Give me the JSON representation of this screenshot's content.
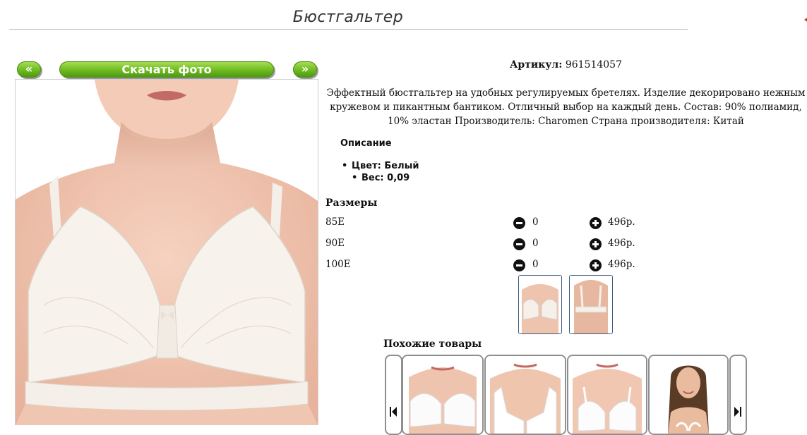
{
  "page": {
    "title": "Бюстгальтер"
  },
  "gallery": {
    "prev_label": "«",
    "download_label": "Скачать фото",
    "next_label": "»"
  },
  "product": {
    "sku_label": "Артикул:",
    "sku_value": "961514057",
    "description": "Эффектный бюстгальтер на удобных регулируемых бретелях. Изделие декорировано нежным кружевом и пикантным бантиком. Отличный выбор на каждый день. Состав: 90% полиамид, 10% эластан Производитель: Charomen Страна производителя: Китай",
    "description_heading": "Описание",
    "attributes": [
      "Цвет: Белый",
      "Вес: 0,09"
    ]
  },
  "sizes": {
    "heading": "Размеры",
    "rows": [
      {
        "size": "85E",
        "qty": "0",
        "price": "496р."
      },
      {
        "size": "90E",
        "qty": "0",
        "price": "496р."
      },
      {
        "size": "100E",
        "qty": "0",
        "price": "496р."
      }
    ]
  },
  "similar": {
    "heading": "Похожие товары"
  },
  "icons": {
    "minus": "minus-circle-icon",
    "plus": "plus-circle-icon",
    "prev": "skip-back-icon",
    "next": "skip-forward-icon"
  },
  "colors": {
    "button_green": "#6dbb1f",
    "thumb_border": "#3d5a80"
  }
}
